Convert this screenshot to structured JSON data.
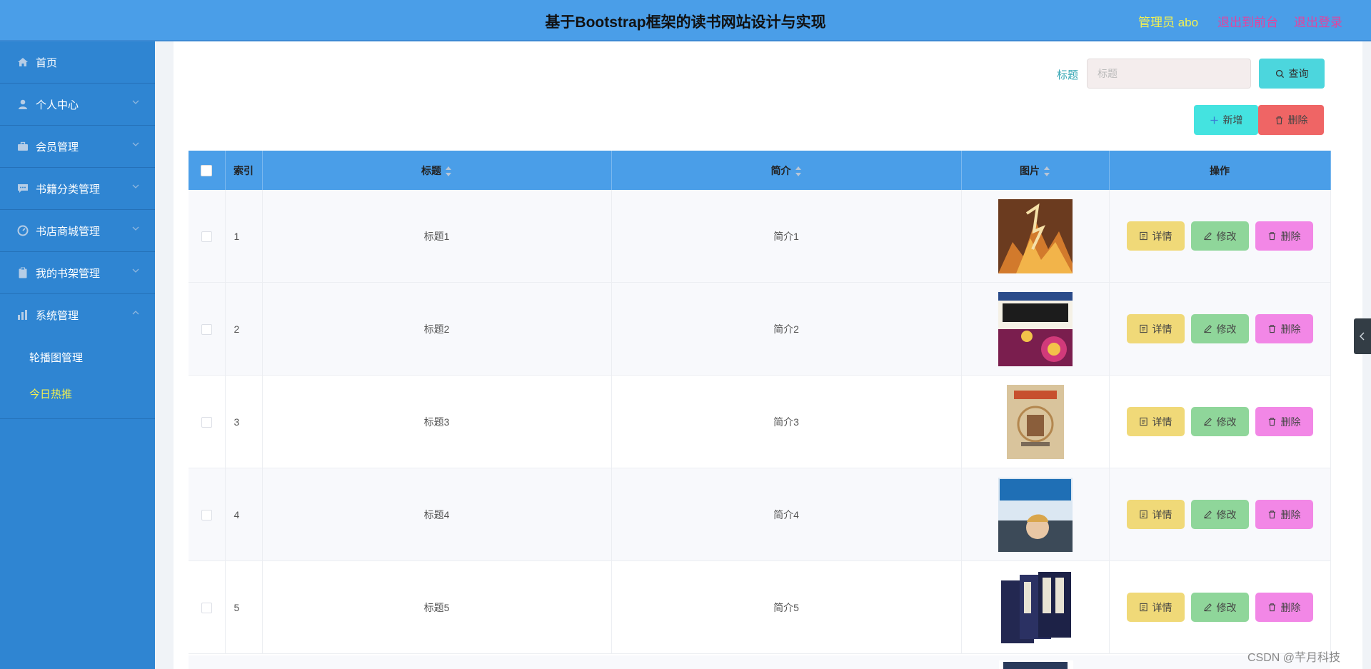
{
  "header": {
    "title": "基于Bootstrap框架的读书网站设计与实现",
    "admin_label": "管理员 abo",
    "front_link": "退出到前台",
    "logout_link": "退出登录"
  },
  "sidebar": {
    "items": [
      {
        "label": "首页",
        "icon": "home-icon"
      },
      {
        "label": "个人中心",
        "icon": "user-icon"
      },
      {
        "label": "会员管理",
        "icon": "briefcase-icon"
      },
      {
        "label": "书籍分类管理",
        "icon": "chat-icon"
      },
      {
        "label": "书店商城管理",
        "icon": "dashboard-icon"
      },
      {
        "label": "我的书架管理",
        "icon": "clipboard-icon"
      },
      {
        "label": "系统管理",
        "icon": "chart-icon"
      }
    ],
    "sub_items": [
      {
        "label": "轮播图管理"
      },
      {
        "label": "今日热推"
      }
    ]
  },
  "search": {
    "label": "标题",
    "placeholder": "标题",
    "button_label": "查询"
  },
  "toolbar": {
    "add_label": "新增",
    "delete_label": "删除"
  },
  "table": {
    "columns": [
      "索引",
      "标题",
      "简介",
      "图片",
      "操作"
    ],
    "rows": [
      {
        "index": "1",
        "title": "标题1",
        "intro": "简介1",
        "cover": "book-cover-dark-fire"
      },
      {
        "index": "2",
        "title": "标题2",
        "intro": "简介2",
        "cover": "book-cover-aerobics"
      },
      {
        "index": "3",
        "title": "标题3",
        "intro": "简介3",
        "cover": "book-cover-illustrated"
      },
      {
        "index": "4",
        "title": "标题4",
        "intro": "简介4",
        "cover": "book-cover-traveler"
      },
      {
        "index": "5",
        "title": "标题5",
        "intro": "简介5",
        "cover": "book-cover-boxset"
      }
    ],
    "actions": {
      "detail": "详情",
      "edit": "修改",
      "delete": "删除"
    }
  },
  "watermark": "CSDN @芊月科技",
  "colors": {
    "header_bg": "#4a9ee8",
    "sidebar_bg": "#2f85d2",
    "highlight_yellow": "#f4f150",
    "link_pink": "#e6419d"
  }
}
